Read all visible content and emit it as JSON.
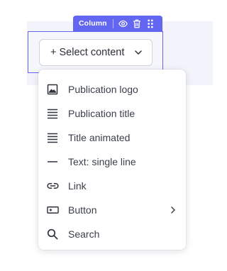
{
  "column_toolbar": {
    "label": "Column",
    "icons": [
      "eye-icon",
      "trash-icon",
      "drag-handle-icon"
    ]
  },
  "select_button": {
    "label": "+ Select content",
    "icon": "chevron-down-icon"
  },
  "colors": {
    "accent": "#6366f1",
    "canvas_bg": "#f3f4fb",
    "text": "#3a3f4a"
  },
  "menu": {
    "items": [
      {
        "label": "Publication logo",
        "icon": "image-icon",
        "submenu": false
      },
      {
        "label": "Publication title",
        "icon": "text-lines-icon",
        "submenu": false
      },
      {
        "label": "Title animated",
        "icon": "text-lines-icon",
        "submenu": false
      },
      {
        "label": "Text: single line",
        "icon": "horizontal-line-icon",
        "submenu": false
      },
      {
        "label": "Link",
        "icon": "link-icon",
        "submenu": false
      },
      {
        "label": "Button",
        "icon": "button-icon",
        "submenu": true
      },
      {
        "label": "Search",
        "icon": "search-icon",
        "submenu": false
      }
    ]
  }
}
